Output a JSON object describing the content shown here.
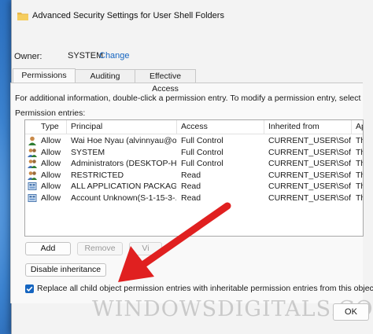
{
  "window": {
    "title": "Advanced Security Settings for User Shell Folders"
  },
  "owner": {
    "label": "Owner:",
    "value": "SYSTEM",
    "change_link": "Change"
  },
  "tabs": [
    {
      "label": "Permissions",
      "active": true
    },
    {
      "label": "Auditing",
      "active": false
    },
    {
      "label": "Effective Access",
      "active": false
    }
  ],
  "info_text": "For additional information, double-click a permission entry. To modify a permission entry, select the entry and",
  "entries_label": "Permission entries:",
  "table": {
    "columns": [
      "Type",
      "Principal",
      "Access",
      "Inherited from",
      "Appli"
    ],
    "rows": [
      {
        "icon": "user-icon",
        "type": "Allow",
        "principal": "Wai Hoe Nyau (alvinnyau@o...",
        "access": "Full Control",
        "inherited": "CURRENT_USER\\Softw...",
        "applies": "This k"
      },
      {
        "icon": "users-icon",
        "type": "Allow",
        "principal": "SYSTEM",
        "access": "Full Control",
        "inherited": "CURRENT_USER\\Softw...",
        "applies": "This k"
      },
      {
        "icon": "users-icon",
        "type": "Allow",
        "principal": "Administrators (DESKTOP-HH...",
        "access": "Full Control",
        "inherited": "CURRENT_USER\\Softw...",
        "applies": "This k"
      },
      {
        "icon": "users-icon",
        "type": "Allow",
        "principal": "RESTRICTED",
        "access": "Read",
        "inherited": "CURRENT_USER\\Softw...",
        "applies": "This k"
      },
      {
        "icon": "package-icon",
        "type": "Allow",
        "principal": "ALL APPLICATION PACKAGES",
        "access": "Read",
        "inherited": "CURRENT_USER\\Softw...",
        "applies": "This k"
      },
      {
        "icon": "package-icon",
        "type": "Allow",
        "principal": "Account Unknown(S-1-15-3-...",
        "access": "Read",
        "inherited": "CURRENT_USER\\Softw...",
        "applies": "This k"
      }
    ]
  },
  "buttons": {
    "add": "Add",
    "remove": "Remove",
    "view": "Vi",
    "disable_inheritance": "Disable inheritance"
  },
  "replace_checkbox": {
    "checked": true,
    "label": "Replace all child object permission entries with inheritable permission entries from this object"
  },
  "footer": {
    "ok": "OK"
  },
  "watermark": "WINDOWSDIGITALS.COM",
  "colors": {
    "accent": "#1565c0",
    "arrow": "#e02020",
    "desktop": "#1d5fa8"
  }
}
